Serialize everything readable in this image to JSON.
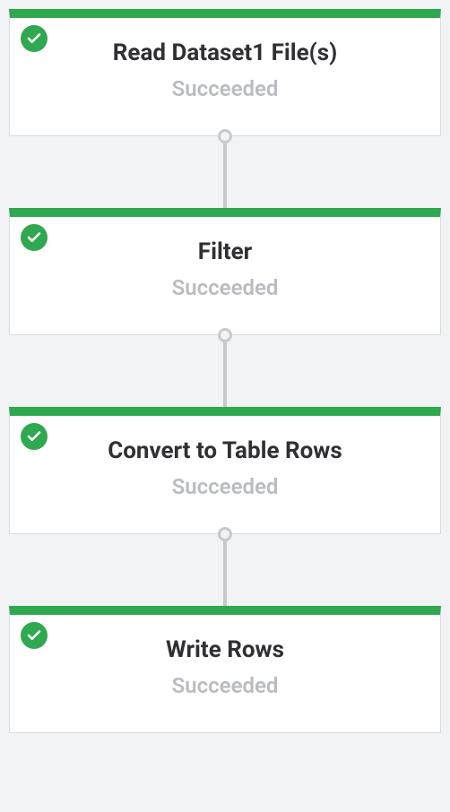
{
  "flow": {
    "nodes": [
      {
        "title": "Read Dataset1 File(s)",
        "status": "Succeeded",
        "state": "success"
      },
      {
        "title": "Filter",
        "status": "Succeeded",
        "state": "success"
      },
      {
        "title": "Convert to Table Rows",
        "status": "Succeeded",
        "state": "success"
      },
      {
        "title": "Write Rows",
        "status": "Succeeded",
        "state": "success"
      }
    ]
  },
  "colors": {
    "success": "#2fa84f",
    "muted": "#b9bcc0",
    "border": "#dadce0",
    "bg": "#f1f3f4"
  }
}
